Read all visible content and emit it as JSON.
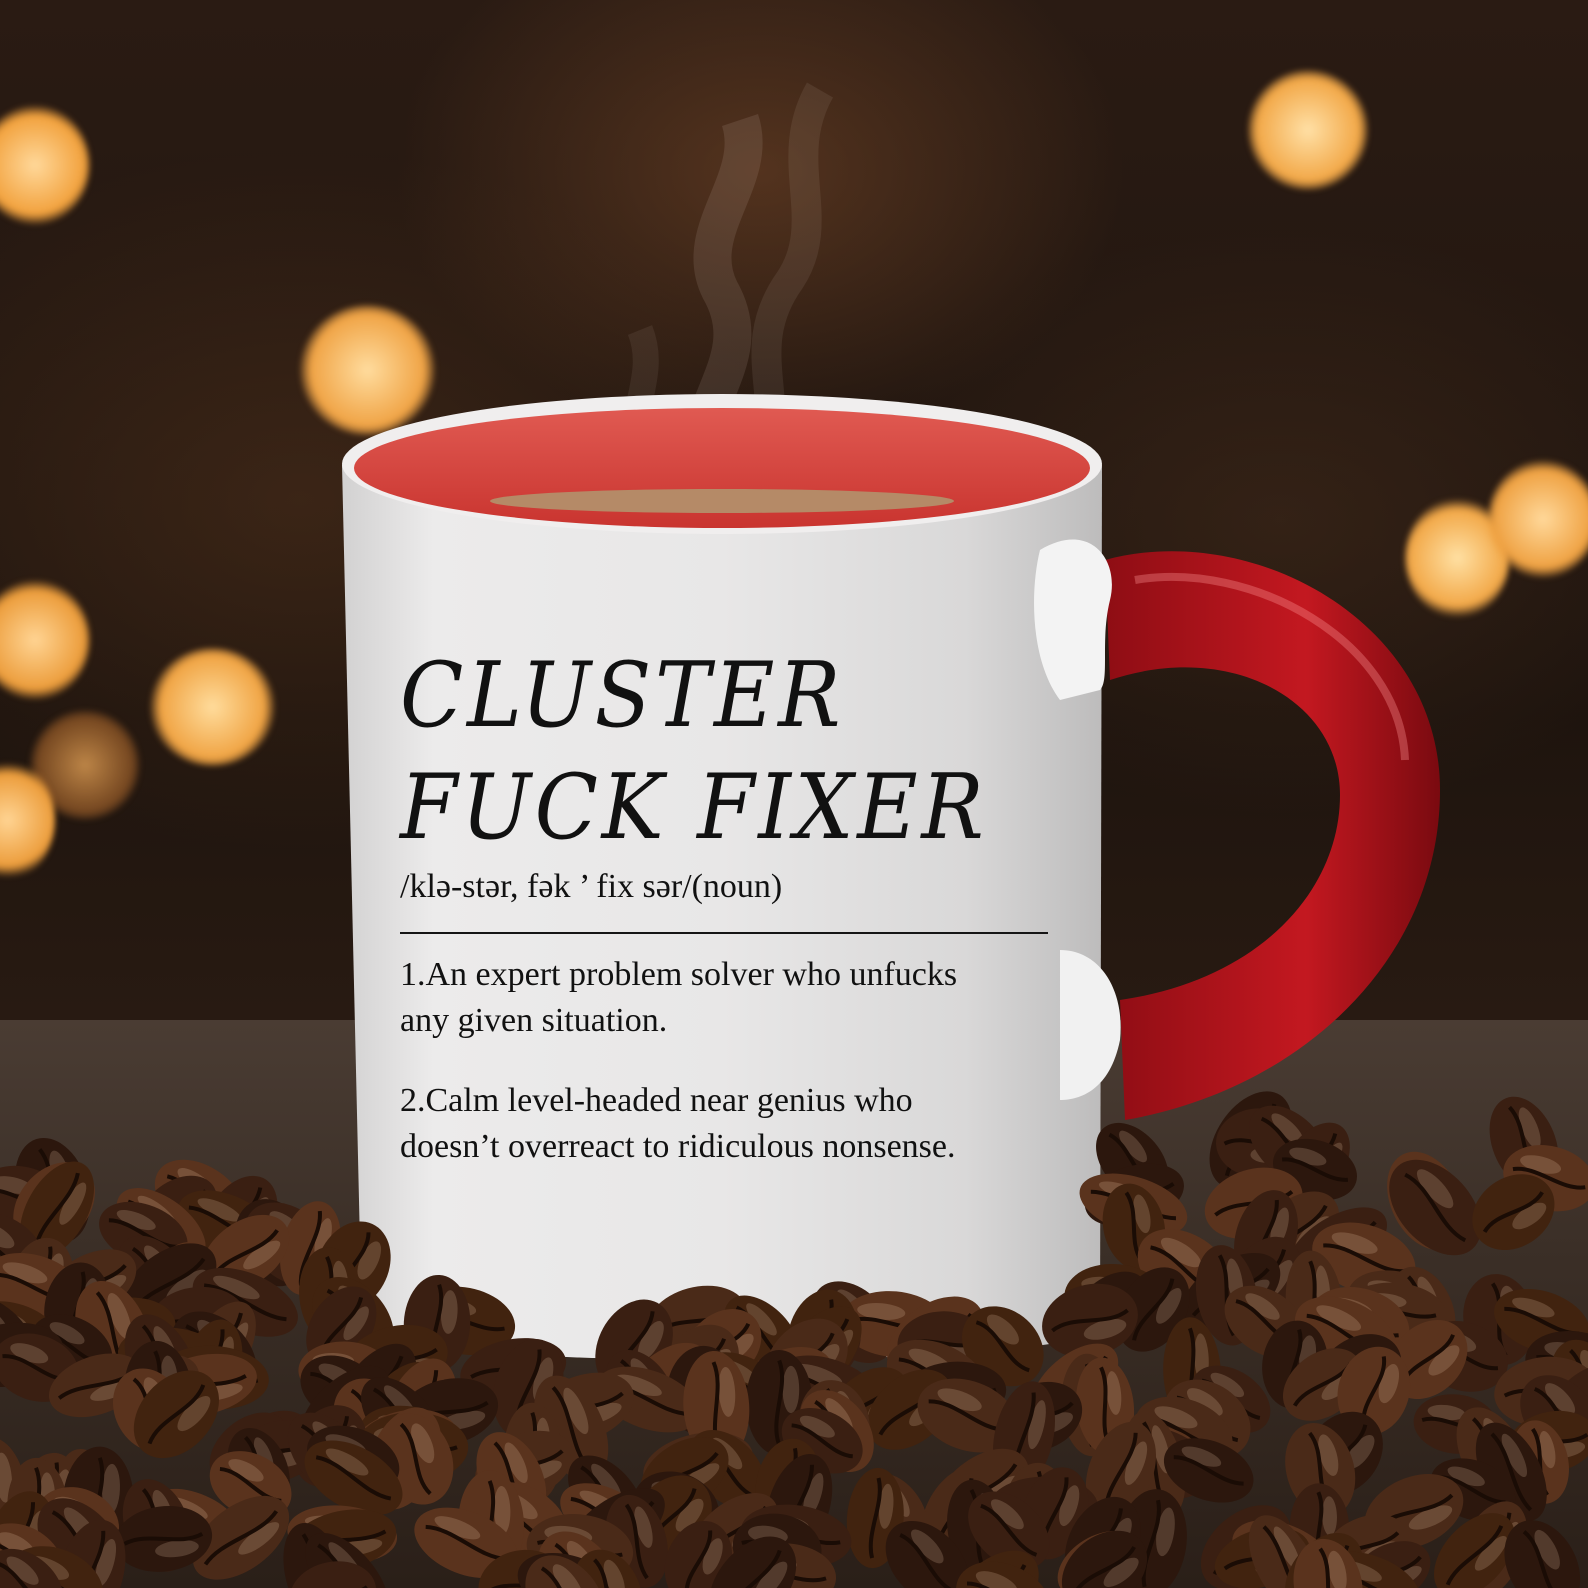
{
  "mug": {
    "title": "CLUSTER\nFUCK FIXER",
    "pronunciation": "/klə-stər, fək ’ fix sər/(noun)",
    "definitions": [
      "1.An expert problem solver who unfucks any given situation.",
      "2.Calm level-headed near genius who doesn’t overreact to ridiculous nonsense."
    ]
  },
  "colors": {
    "mug_body": "#e9e8e8",
    "mug_inner": "#d6453f",
    "handle": "#b8141c",
    "coffee": "#b58a67",
    "bokeh": "#ffc470"
  }
}
